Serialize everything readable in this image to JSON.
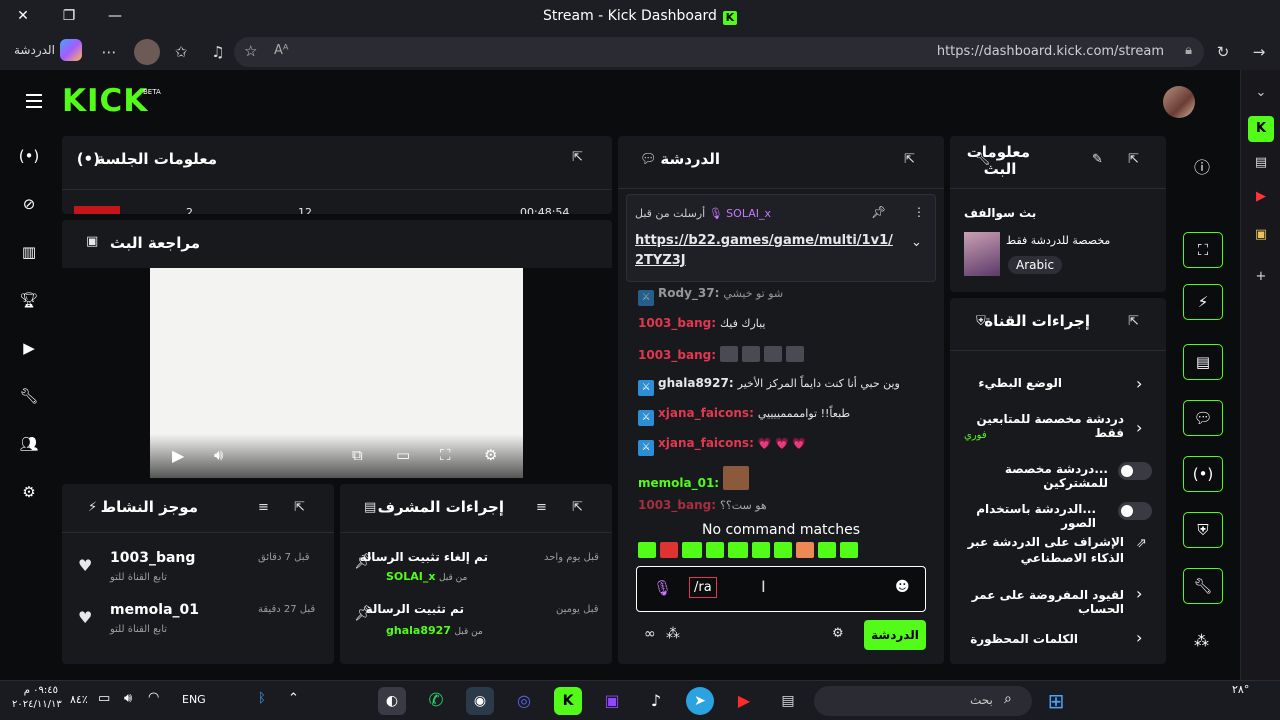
{
  "window": {
    "title": "Stream - Kick Dashboard",
    "title_icon": "K"
  },
  "browser": {
    "chat_label": "الدردشة",
    "url": "https://dashboard.kick.com/stream"
  },
  "app": {
    "logo": "KICK",
    "beta": "BETA",
    "colors": {
      "accent": "#53fc18",
      "panel": "#18191d",
      "bg": "#0b0c0e"
    }
  },
  "session_info": {
    "title": "معلومات الجلسة",
    "partial_values": [
      "2",
      "12",
      "00:48:54"
    ]
  },
  "stream_review": {
    "title": "مراجعة البث"
  },
  "activity": {
    "title": "موجز النشاط",
    "items": [
      {
        "user": "1003_bang",
        "action": "تابع القناة للتو",
        "time": "قبل 7 دقائق"
      },
      {
        "user": "memola_01",
        "action": "تابع القناة للتو",
        "time": "قبل 27 دقيقة"
      }
    ]
  },
  "mod_actions": {
    "title": "إجراءات المشرف",
    "items": [
      {
        "action": "تم إلغاء تثبيت الرسالة",
        "by": "من قبل",
        "user": "SOLAI_x",
        "time": "قبل يوم واحد"
      },
      {
        "action": "تم تثبيت الرسالة",
        "by": "من قبل",
        "user": "ghala8927",
        "time": "قبل يومين"
      }
    ]
  },
  "chat": {
    "title": "الدردشة",
    "pinned": {
      "sent_by": "أرسلت من قبل",
      "user": "SOLAI_x",
      "link": "https://b22.games/game/multi/1v1/2TYZ3J"
    },
    "messages": [
      {
        "user": "Rody_37:",
        "text": "شو تو خيشي",
        "color": "#e8e8e8",
        "badge": true
      },
      {
        "user": "1003_bang:",
        "text": "يبارك فيك",
        "color": "#e2374f",
        "badge": false
      },
      {
        "user": "1003_bang:",
        "text": "",
        "color": "#e2374f",
        "badge": false,
        "emotes": 4
      },
      {
        "user": "ghala8927:",
        "text": "وين حبي أنا كنت دايماً المركز الأخير",
        "color": "#e8e8e8",
        "badge": true
      },
      {
        "user": "xjana_faicons:",
        "text": "طبعاً!! تواممممييييي",
        "color": "#e2374f",
        "badge": true
      },
      {
        "user": "xjana_faicons:",
        "text": "💗 💗 💗",
        "color": "#e2374f",
        "badge": true
      },
      {
        "user": "memola_01:",
        "text": "",
        "color": "#53fc18",
        "badge": false,
        "emotes": 1
      },
      {
        "user": "1003_bang:",
        "text": "هو ست؟؟",
        "color": "#e2374f",
        "badge": false
      }
    ],
    "no_match": "No command matches",
    "input_value": "/ra",
    "send_label": "الدردشة"
  },
  "stream_info": {
    "title": "معلومات البث",
    "stream_title": "بث سوالفف",
    "category": "مخصصة للدردشة فقط",
    "language": "Arabic"
  },
  "channel_actions": {
    "title": "إجراءات القناة",
    "items": [
      {
        "label": "الوضع البطيء",
        "sub": "",
        "control": "chevron"
      },
      {
        "label": "دردشة مخصصة للمتابعين فقط",
        "sub": "فوري",
        "control": "chevron"
      },
      {
        "label": "...دردشة مخصصة للمشتركين",
        "sub": "",
        "control": "toggle"
      },
      {
        "label": "...الدردشة باستخدام الصور",
        "sub": "",
        "control": "toggle"
      },
      {
        "label": "الإشراف على الدردشة عبر الذكاء الاصطناعي",
        "sub": "",
        "control": "external"
      },
      {
        "label": "لقيود المفروضة على عمر الحساب",
        "sub": "",
        "control": "chevron"
      },
      {
        "label": "الكلمات المحظورة",
        "sub": "",
        "control": "chevron"
      }
    ]
  },
  "taskbar": {
    "time": "٠٩:٤٥ م",
    "date": "٢٠٢٤/١١/١٣",
    "battery": "٨٤٪",
    "lang": "ENG",
    "search_placeholder": "بحث",
    "temp": "٢٨°"
  }
}
